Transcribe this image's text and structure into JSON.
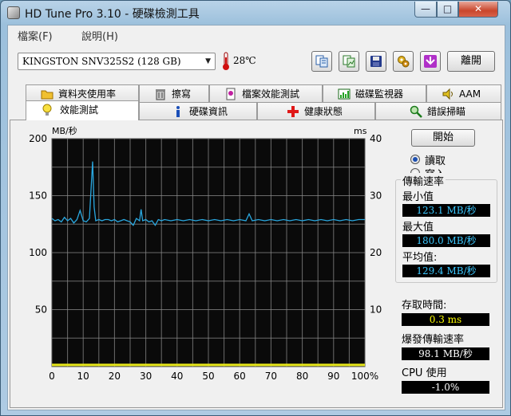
{
  "window": {
    "title": "HD Tune Pro 3.10 - 硬碟檢測工具",
    "minimize": "—",
    "maximize": "□",
    "close": "✕"
  },
  "menu": {
    "file": "檔案(F)",
    "help": "說明(H)"
  },
  "toolbar": {
    "drive": "KINGSTON SNV325S2 (128 GB)",
    "temperature": "28℃",
    "exit_label": "離開",
    "icons": [
      "copy-text-icon",
      "copy-image-icon",
      "save-icon",
      "options-icon",
      "download-icon"
    ]
  },
  "tabs_top": [
    {
      "label": "資料夾使用率",
      "icon": "folder-icon"
    },
    {
      "label": "擦寫",
      "icon": "trash-icon"
    },
    {
      "label": "檔案效能測試",
      "icon": "file-benchmark-icon"
    },
    {
      "label": "磁碟監視器",
      "icon": "monitor-icon"
    },
    {
      "label": "AAM",
      "icon": "speaker-icon"
    }
  ],
  "tabs_bottom": [
    {
      "label": "效能測試",
      "icon": "bulb-icon"
    },
    {
      "label": "硬碟資訊",
      "icon": "info-icon"
    },
    {
      "label": "健康狀態",
      "icon": "health-cross-icon"
    },
    {
      "label": "錯誤掃瞄",
      "icon": "magnifier-icon"
    }
  ],
  "controls": {
    "start": "開始",
    "read": "讀取",
    "write": "寫入",
    "selected_mode": "read"
  },
  "stats": {
    "transfer_rate_title": "傳輸速率",
    "min_label": "最小值",
    "min_value": "123.1 MB/秒",
    "max_label": "最大值",
    "max_value": "180.0 MB/秒",
    "avg_label": "平均值:",
    "avg_value": "129.4 MB/秒",
    "access_label": "存取時間:",
    "access_value": "0.3 ms",
    "burst_label": "爆發傳輸速率",
    "burst_value": "98.1 MB/秒",
    "cpu_label": "CPU 使用",
    "cpu_value": "-1.0%"
  },
  "chart_data": {
    "type": "line",
    "left_unit": "MB/秒",
    "right_unit": "ms",
    "ylim": [
      0,
      200
    ],
    "ylim_right": [
      0,
      40
    ],
    "y_ticks": [
      200,
      150,
      100,
      50
    ],
    "y2_ticks": [
      40,
      30,
      20,
      10
    ],
    "x_ticks": [
      "0",
      "10",
      "20",
      "30",
      "40",
      "50",
      "60",
      "70",
      "80",
      "90",
      "100%"
    ],
    "xlim": [
      0,
      100
    ],
    "grid": true,
    "colors": {
      "transfer": "#2aa8e0",
      "access": "#e8e81a",
      "grid": "#8c8c8c",
      "plot_bg": "#0a0a0a"
    },
    "series": [
      {
        "color": "#2aa8e0",
        "x": [
          0,
          1,
          2,
          3,
          4,
          5,
          6,
          7,
          8,
          9,
          10,
          11,
          12,
          12.5,
          13,
          13.5,
          14,
          15,
          16,
          17,
          18,
          19,
          20,
          21,
          22,
          23,
          24,
          25,
          26,
          27,
          28,
          28.5,
          29,
          30,
          31,
          32,
          33,
          34,
          35,
          36,
          38,
          40,
          42,
          44,
          46,
          48,
          50,
          52,
          54,
          56,
          58,
          60,
          62,
          63,
          64,
          66,
          68,
          70,
          72,
          74,
          76,
          78,
          80,
          82,
          84,
          86,
          88,
          90,
          92,
          94,
          96,
          98,
          100
        ],
        "y": [
          130,
          128,
          129,
          127,
          131,
          128,
          130,
          126,
          129,
          137,
          128,
          127,
          130,
          155,
          180,
          140,
          128,
          129,
          128,
          129,
          129,
          128,
          129,
          127,
          128,
          129,
          128,
          127,
          124,
          130,
          128,
          138,
          128,
          129,
          127,
          128,
          124,
          129,
          128,
          129,
          128,
          129,
          128,
          129,
          128,
          129,
          128,
          129,
          128,
          129,
          128,
          129,
          128,
          134,
          128,
          129,
          128,
          129,
          128,
          129,
          128,
          129,
          128,
          129,
          128,
          129,
          128,
          129,
          128,
          129,
          128,
          129,
          129
        ]
      },
      {
        "color": "#e8e81a",
        "axis": "right",
        "x": [
          0,
          100
        ],
        "y": [
          0.3,
          0.3
        ]
      }
    ]
  }
}
